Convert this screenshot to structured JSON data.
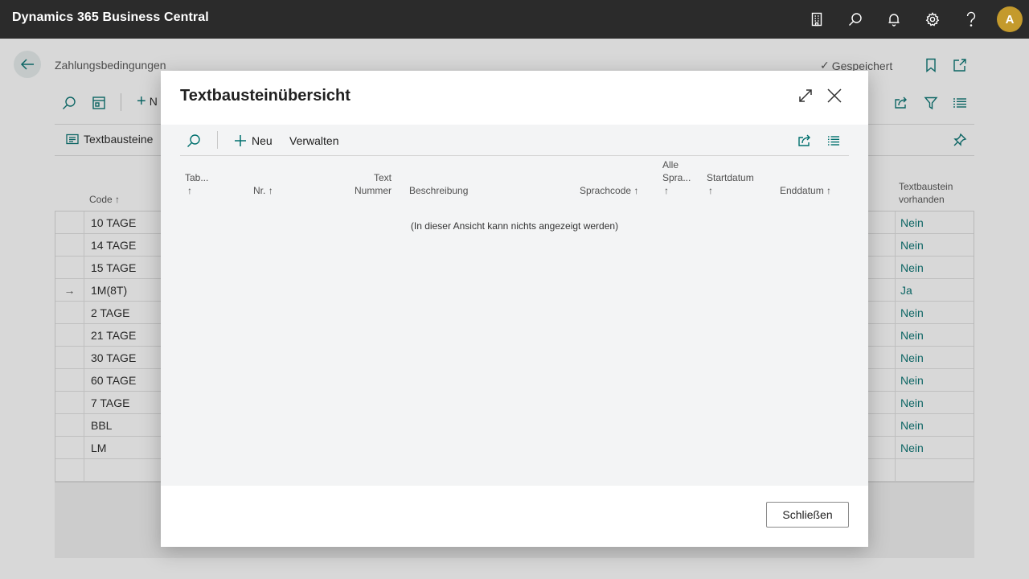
{
  "app": {
    "title": "Dynamics 365 Business Central",
    "avatar_initial": "A"
  },
  "topbar_icons": [
    "company-icon",
    "search-icon",
    "bell-icon",
    "gear-icon",
    "help-icon"
  ],
  "page": {
    "breadcrumb": "Zahlungsbedingungen",
    "saved_label": "Gespeichert",
    "new_label_partial": "N",
    "promoted_action": "Textbausteine",
    "columns": {
      "code": "Code",
      "text_exists": "Textbaustein vorhanden"
    },
    "rows": [
      {
        "code": "10 TAGE",
        "value": "Nein",
        "current": false
      },
      {
        "code": "14 TAGE",
        "value": "Nein",
        "current": false
      },
      {
        "code": "15 TAGE",
        "value": "Nein",
        "current": false
      },
      {
        "code": "1M(8T)",
        "value": "Ja",
        "current": true
      },
      {
        "code": "2 TAGE",
        "value": "Nein",
        "current": false
      },
      {
        "code": "21 TAGE",
        "value": "Nein",
        "current": false
      },
      {
        "code": "30 TAGE",
        "value": "Nein",
        "current": false
      },
      {
        "code": "60 TAGE",
        "value": "Nein",
        "current": false
      },
      {
        "code": "7 TAGE",
        "value": "Nein",
        "current": false
      },
      {
        "code": "BBL",
        "value": "Nein",
        "current": false
      },
      {
        "code": "LM",
        "value": "Nein",
        "current": false
      }
    ]
  },
  "dialog": {
    "title": "Textbausteinübersicht",
    "toolbar": {
      "new_label": "Neu",
      "manage_label": "Verwalten"
    },
    "columns": {
      "tab_line1": "Tab...",
      "nr": "Nr.",
      "text_line1": "Text",
      "text_line2": "Nummer",
      "description": "Beschreibung",
      "language_code": "Sprachcode",
      "all_lang_line1": "Alle",
      "all_lang_line2": "Spra...",
      "start_date": "Startdatum",
      "end_date": "Enddatum",
      "sort_arrow": "↑"
    },
    "empty_message": "(In dieser Ansicht kann nichts angezeigt werden)",
    "close_label": "Schließen"
  },
  "colors": {
    "accent": "#00706e",
    "topbar": "#2b2b2b",
    "avatar": "#c49a2c"
  }
}
